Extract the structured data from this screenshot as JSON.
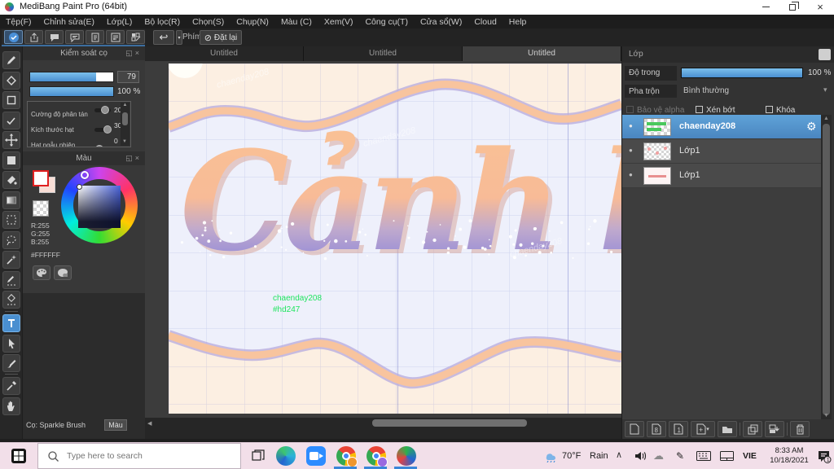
{
  "window": {
    "title": "MediBang Paint Pro (64bit)",
    "menu": [
      "Tệp(F)",
      "Chỉnh sửa(E)",
      "Lớp(L)",
      "Bộ lọc(R)",
      "Chọn(S)",
      "Chụp(N)",
      "Màu (C)",
      "Xem(V)",
      "Công cụ(T)",
      "Cửa sổ(W)",
      "Cloud",
      "Help"
    ]
  },
  "toolbar": {
    "key_label": "Phím",
    "reset_label": "Đặt lại"
  },
  "brush_panel": {
    "title": "Kiểm soát cọ",
    "size_value": "79",
    "opacity_value": "100 %",
    "params": [
      {
        "label": "Cường độ phân tán",
        "value": "20"
      },
      {
        "label": "Kích thước hạt",
        "value": "30"
      },
      {
        "label": "Hạt ngẫu nhiên",
        "value": "0"
      }
    ]
  },
  "color_panel": {
    "title": "Màu",
    "r": "R:255",
    "g": "G:255",
    "b": "B:255",
    "hex": "#FFFFFF"
  },
  "left_status": {
    "brush_name": "Cọ: Sparkle Brush",
    "color_button": "Màu"
  },
  "tabs": [
    {
      "label": "Untitled"
    },
    {
      "label": "Untitled"
    },
    {
      "label": "Untitled"
    }
  ],
  "canvas": {
    "headline": "Cảnh báo",
    "signature_line1": "chaenday208",
    "signature_line2": "#hd247",
    "watermark": "chaenday208",
    "headline_top_color": "#f9c095",
    "headline_bottom_color": "#9c90d6",
    "signature_color": "#1ee55e"
  },
  "layers_panel": {
    "title": "Lớp",
    "opacity_label": "Độ trong",
    "opacity_value": "100 %",
    "blend_label": "Pha trộn",
    "blend_value": "Bình thường",
    "check_alpha": "Bảo vệ alpha",
    "check_clip": "Xén bớt",
    "check_lock": "Khóa",
    "layers": [
      {
        "name": "chaenday208"
      },
      {
        "name": "Lớp1"
      },
      {
        "name": "Lớp1"
      }
    ]
  },
  "taskbar": {
    "search_placeholder": "Type here to search",
    "weather_temp": "70°F",
    "weather_cond": "Rain",
    "language": "VIE",
    "time": "8:33 AM",
    "date": "10/18/2021",
    "badge": "1"
  },
  "icons": {
    "undo": "↩",
    "no_symbol": "⊘",
    "popout": "◱",
    "close": "×",
    "dropdown": "▾",
    "scroll_up": "▲",
    "scroll_down": "▼",
    "scroll_left": "◀",
    "visibility_dot": "●",
    "gear": "⚙",
    "chevron_up": "∧",
    "onedrive_cloud": "☁",
    "ink_pen": "✎",
    "layer_8bit": "8",
    "layer_1bit": "1",
    "layer_plus": "+",
    "window_close": "×"
  }
}
